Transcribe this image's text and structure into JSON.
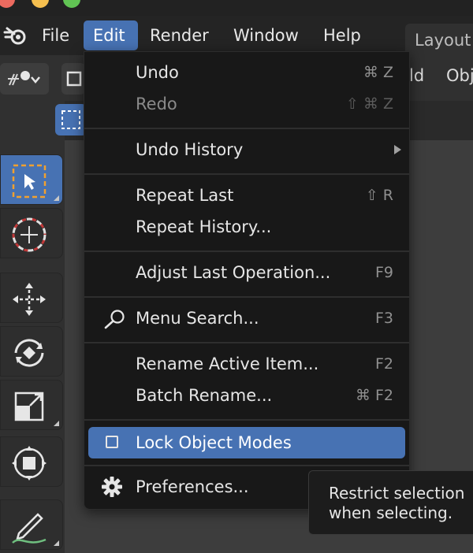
{
  "menubar": {
    "items": [
      {
        "label": "File"
      },
      {
        "label": "Edit"
      },
      {
        "label": "Render"
      },
      {
        "label": "Window"
      },
      {
        "label": "Help"
      }
    ],
    "workspace_tab": "Layout"
  },
  "header": {
    "partial_text_1": "ld",
    "partial_text_2": "Obj"
  },
  "edit_menu": {
    "items": [
      {
        "label": "Undo",
        "shortcut": "⌘ Z",
        "enabled": true
      },
      {
        "label": "Redo",
        "shortcut": "⇧ ⌘ Z",
        "enabled": false
      },
      {
        "label": "Undo History",
        "submenu": true
      },
      {
        "label": "Repeat Last",
        "shortcut": "⇧ R"
      },
      {
        "label": "Repeat History..."
      },
      {
        "label": "Adjust Last Operation...",
        "shortcut": "F9"
      },
      {
        "label": "Menu Search...",
        "shortcut": "F3",
        "icon": "search-icon"
      },
      {
        "label": "Rename Active Item...",
        "shortcut": "F2"
      },
      {
        "label": "Batch Rename...",
        "shortcut": "⌘ F2"
      },
      {
        "label": "Lock Object Modes",
        "checkbox": false,
        "highlighted": true
      },
      {
        "label": "Preferences...",
        "icon": "gear-icon"
      }
    ]
  },
  "tooltip": {
    "text": "Restrict selection\nwhen selecting."
  },
  "colors": {
    "accent": "#4772b3",
    "menu_bg": "#181818",
    "app_bg": "#303030"
  },
  "toolbar": {
    "tools": [
      "select-box-icon",
      "cursor-icon",
      "move-icon",
      "rotate-icon",
      "scale-icon",
      "transform-icon",
      "annotate-icon"
    ]
  }
}
